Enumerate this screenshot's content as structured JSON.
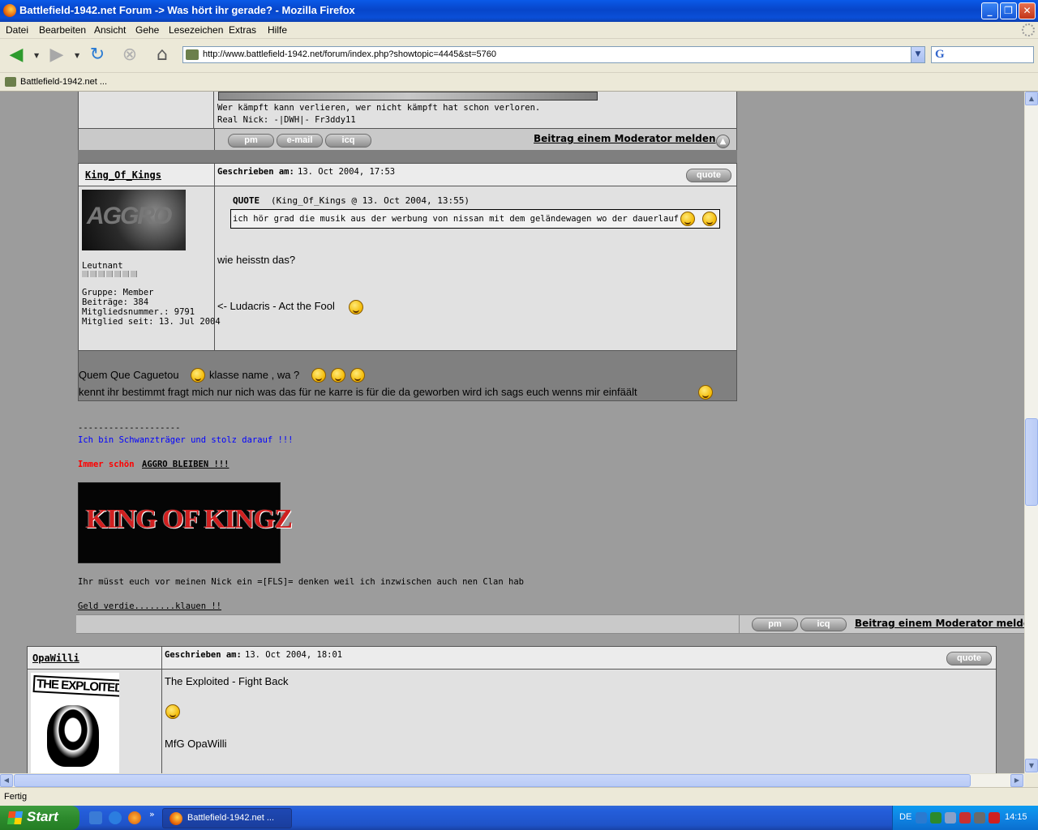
{
  "window": {
    "title": "Battlefield-1942.net Forum -> Was hört ihr gerade? - Mozilla Firefox",
    "minimize": "_",
    "maximize": "❐",
    "close": "✕"
  },
  "menu": [
    "Datei",
    "Bearbeiten",
    "Ansicht",
    "Gehe",
    "Lesezeichen",
    "Extras",
    "Hilfe"
  ],
  "toolbar": {
    "url": "http://www.battlefield-1942.net/forum/index.php?showtopic=4445&st=5760",
    "icons": [
      "back-icon",
      "forward-icon",
      "reload-icon",
      "stop-icon",
      "home-icon"
    ]
  },
  "bookmarks": {
    "item": "Battlefield-1942.net ..."
  },
  "prev_post": {
    "sig_line1": "Wer kämpft kann verlieren, wer nicht kämpft hat schon verloren.",
    "sig_line2": "Real Nick: -|DWH|- Fr3ddy11",
    "buttons": [
      "pm",
      "e-mail",
      "icq"
    ],
    "report": "Beitrag einem Moderator melden"
  },
  "post1": {
    "author": "King_Of_Kings",
    "written_label": "Geschrieben am:",
    "date": "13. Oct 2004, 17:53",
    "quote_btn": "quote",
    "avatar_text": "AGGRO",
    "rank": "Leutnant",
    "group": "Gruppe: Member",
    "posts": "Beiträge: 384",
    "member_no": "Mitgliedsnummer.: 9791",
    "member_since": "Mitglied seit: 13. Jul 2004",
    "quote_label": "QUOTE",
    "quote_src": "(King_Of_Kings @ 13. Oct 2004, 13:55)",
    "quote_text": "ich hör grad die musik aus der werbung von nissan mit dem geländewagen wo der dauerlauf is",
    "body1": "wie heisstn das?",
    "body2": "<- Ludacris - Act the Fool",
    "dark1_a": "Quem Que Caguetou",
    "dark1_b": "klasse name , wa ?",
    "dark2": "kennt ihr bestimmt fragt mich nur nich was das für ne karre is für die da geworben wird ich sags euch wenns mir einfäält",
    "sig_dashes": "--------------------",
    "sig_blue": "Ich bin Schwanzträger und stolz darauf !!!",
    "sig_red": "Immer schön",
    "sig_aggro": "AGGRO BLEIBEN !!!",
    "banner": "KING OF KINGZ",
    "sig_nick": "Ihr müsst euch vor meinen Nick ein =[FLS]= denken weil ich inzwischen auch nen Clan hab",
    "sig_geld": "Geld verdie........klauen !!",
    "buttons": [
      "pm",
      "icq"
    ],
    "report": "Beitrag einem Moderator melde"
  },
  "post2": {
    "author": "OpaWilli",
    "written_label": "Geschrieben am:",
    "date": "13. Oct 2004, 18:01",
    "quote_btn": "quote",
    "avatar_text": "THE EXPLOITED",
    "body1": "The Exploited - Fight Back",
    "body2": "MfG OpaWilli"
  },
  "status": "Fertig",
  "taskbar": {
    "start": "Start",
    "window_btn": "Battlefield-1942.net ...",
    "lang": "DE",
    "clock": "14:15"
  }
}
